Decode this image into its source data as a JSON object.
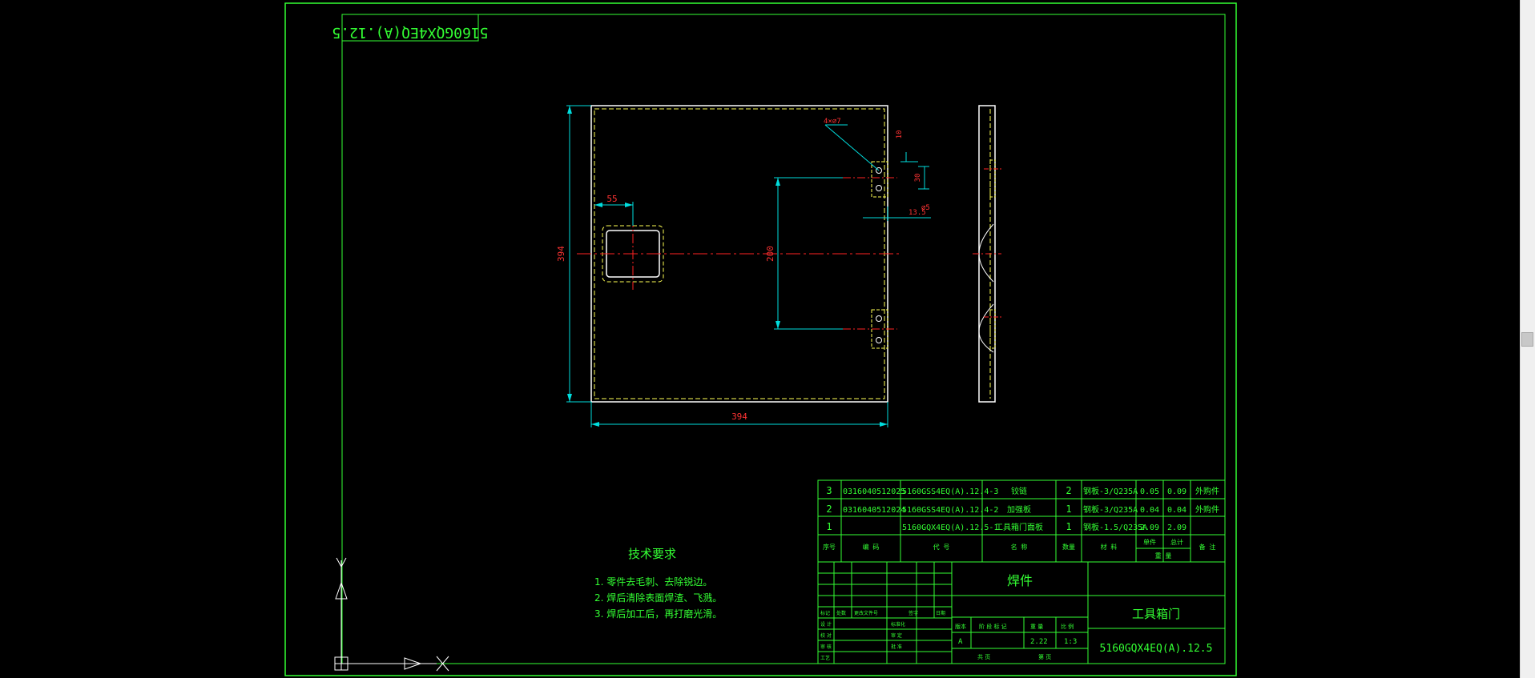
{
  "window": {
    "title": ""
  },
  "drawing": {
    "corner_stamp": "5160GQX4EQ(A).12.5",
    "dims": {
      "width_394": "394",
      "height_394": "394",
      "dim_55": "55",
      "dim_200": "200",
      "dim_10": "10",
      "dim_30": "30",
      "dim_13_5": "13.5",
      "dim_phi5": "⌀5",
      "holes": "4×⌀7"
    },
    "tech_req": {
      "title": "技术要求",
      "items": [
        "1. 零件去毛刺、去除锐边。",
        "2. 焊后清除表面焊渣、飞溅。",
        "3. 焊后加工后，再打磨光滑。"
      ]
    },
    "bom": {
      "rows": [
        {
          "no": "3",
          "code": "0316040512025",
          "part": "5160GSS4EQ(A).12.4-3",
          "name": "铰链",
          "qty": "2",
          "material": "钢板-3/Q235A",
          "w1": "0.05",
          "w2": "0.09",
          "note": "外购件"
        },
        {
          "no": "2",
          "code": "0316040512024",
          "part": "5160GSS4EQ(A).12.4-2",
          "name": "加强板",
          "qty": "1",
          "material": "钢板-3/Q235A",
          "w1": "0.04",
          "w2": "0.04",
          "note": "外购件"
        },
        {
          "no": "1",
          "code": "",
          "part": "5160GQX4EQ(A).12.5-1",
          "name": "工具箱门面板",
          "qty": "1",
          "material": "钢板-1.5/Q235A",
          "w1": "2.09",
          "w2": "2.09",
          "note": ""
        }
      ],
      "header": {
        "no": "序号",
        "code": "编 码",
        "part": "代 号",
        "name": "名 称",
        "qty": "数量",
        "material": "材 料",
        "unit": "单件",
        "total": "总计",
        "weight": "重 量",
        "note": "备 注"
      }
    },
    "title_block": {
      "type": "焊件",
      "name": "工具箱门",
      "drawing_no": "5160GQX4EQ(A).12.5",
      "labels": {
        "mark": "标记",
        "count": "处数",
        "zone": "更改文件号",
        "sign": "签字",
        "date": "日期",
        "design": "设 计",
        "check": "校 对",
        "review": "审 核",
        "process": "工艺",
        "standard": "标准化",
        "approve": "审 定",
        "approve2": "批 准",
        "stage": "阶 段 标 记",
        "weight": "重 量",
        "scale": "比 例",
        "version": "版本",
        "sheets": "共  页",
        "sheet": "第  页"
      },
      "values": {
        "version": "A",
        "weight": "2.22",
        "scale": "1:3"
      }
    },
    "ucs": {
      "x": "X",
      "y": "Y"
    }
  },
  "colors": {
    "frame": "#33ff33",
    "part": "#ffffff",
    "dim": "#00dddd",
    "centerline": "#ff2222",
    "hidden": "#ffff55"
  }
}
